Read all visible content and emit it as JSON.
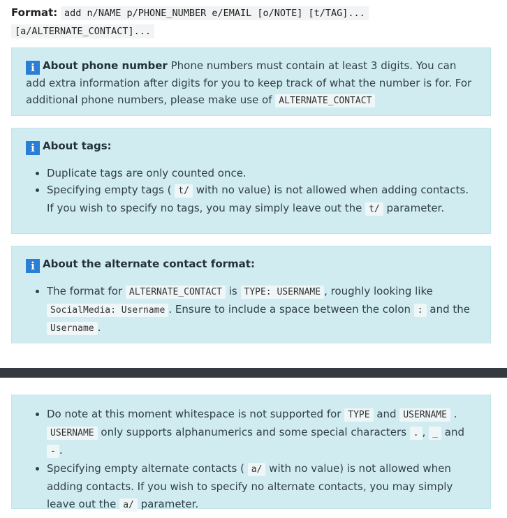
{
  "format": {
    "label": "Format:",
    "line1": "add n/NAME p/PHONE_NUMBER e/EMAIL [o/NOTE] [t/TAG]...",
    "line2": "[a/ALTERNATE_CONTACT]..."
  },
  "phone_box": {
    "title": "About phone number",
    "text": "Phone numbers must contain at least 3 digits. You can add extra information after digits for you to keep track of what the number is for. For additional phone numbers, please make use of",
    "code": "ALTERNATE_CONTACT"
  },
  "tags_box": {
    "title": "About tags:",
    "item1": "Duplicate tags are only counted once.",
    "item2_a": "Specifying empty tags (",
    "item2_code": "t/",
    "item2_b": "with no value) is not allowed when adding contacts. If you wish to specify no tags, you may simply leave out the",
    "item2_code2": "t/",
    "item2_c": "parameter."
  },
  "alt_box": {
    "title": "About the alternate contact format:",
    "item1_a": "The format for",
    "item1_code1": "ALTERNATE_CONTACT",
    "item1_b": "is",
    "item1_code2": "TYPE: USERNAME",
    "item1_c": ", roughly looking like",
    "item1_code3": "SocialMedia: Username",
    "item1_d": ". Ensure to include a space between the colon",
    "item1_code4": ":",
    "item1_e": "and the",
    "item1_code5": "Username",
    "item1_f": "."
  },
  "alt_box_cont": {
    "item2_a": "Do note at this moment whitespace is not supported for",
    "item2_code1": "TYPE",
    "item2_b": "and",
    "item2_code2": "USERNAME",
    "item2_c": ".",
    "item2_code3": "USERNAME",
    "item2_d": "only supports alphanumerics and some special characters",
    "item2_code4": ".",
    "item2_e": ",",
    "item2_code5": "_",
    "item2_f": "and",
    "item2_code6": "-",
    "item2_g": ".",
    "item3_a": "Specifying empty alternate contacts (",
    "item3_code1": "a/",
    "item3_b": "with no value) is not allowed when adding contacts. If you wish to specify no alternate contacts, you may simply leave out the",
    "item3_code2": "a/",
    "item3_c": "parameter."
  }
}
